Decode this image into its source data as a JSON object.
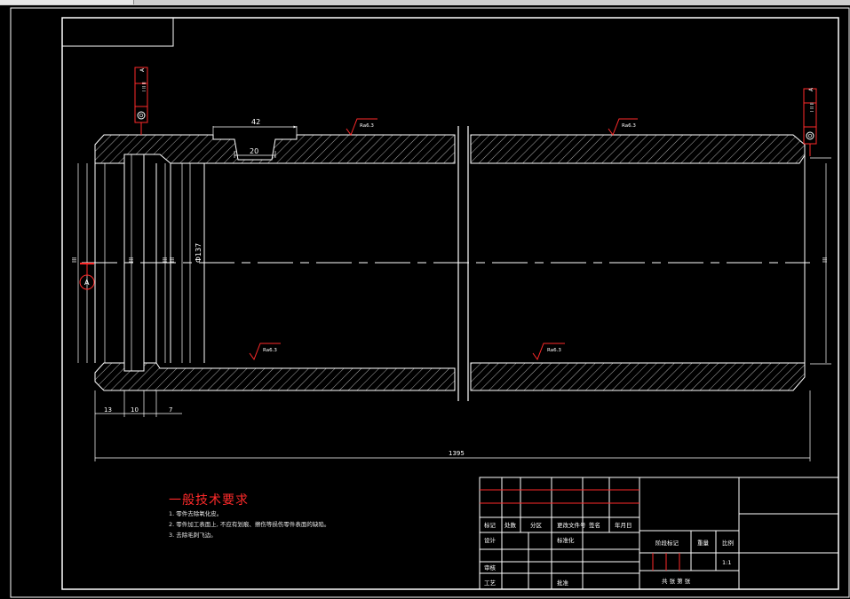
{
  "drawing": {
    "dimensions": {
      "length_overall": "1395",
      "width_top": "42",
      "width_slot": "20",
      "seg_13": "13",
      "seg_10": "10",
      "seg_7": "7",
      "dia_bore": "Ф137"
    },
    "roughness": [
      "Ra6.3",
      "Ra6.3",
      "Ra6.3",
      "Ra6.3"
    ],
    "datum_label": "A",
    "tolerance_frames": [
      {
        "symbol": "A",
        "label": "I II II"
      },
      {
        "symbol": "A",
        "label": "I II II"
      }
    ]
  },
  "notes": {
    "title": "一般技术要求",
    "lines": [
      "1. 零件去除氧化皮。",
      "2. 零件加工表面上, 不应有划痕、擦伤等损伤零件表面的缺陷。",
      "3. 去除毛刺飞边。"
    ]
  },
  "title_block": {
    "row_labels": [
      "标记",
      "处数",
      "分区",
      "更改文件号",
      "签名",
      "年月日"
    ],
    "design": "设计",
    "standardize": "标准化",
    "review": "审核",
    "process": "工艺",
    "approve": "批准",
    "stage_mark": "阶段标记",
    "weight": "重量",
    "scale": "比例",
    "scale_value": "1:1",
    "sheets": "共  张  第  张"
  },
  "colors": {
    "background": "#000000",
    "lines": "#ffffff",
    "accent": "#ff0000",
    "hatch": "#d8d8d8"
  }
}
